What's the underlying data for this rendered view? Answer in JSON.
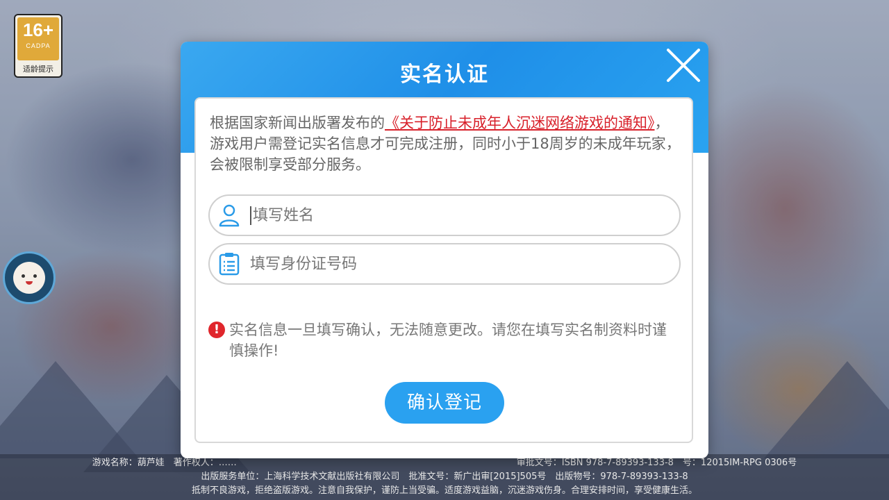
{
  "age_badge": {
    "rating": "16+",
    "org": "CADPA",
    "tip": "适龄提示"
  },
  "modal": {
    "title": "实名认证",
    "notice_prefix": "根据国家新闻出版署发布的",
    "notice_link": "《关于防止未成年人沉迷网络游戏的通知》",
    "notice_suffix": "，游戏用户需登记实名信息才可完成注册，同时小于18周岁的未成年玩家，会被限制享受部分服务。",
    "name_placeholder": "填写姓名",
    "id_placeholder": "填写身份证号码",
    "warning": "实名信息一旦填写确认，无法随意更改。请您在填写实名制资料时谨慎操作!",
    "confirm_label": "确认登记"
  },
  "footer": {
    "line1": "游戏名称：葫芦娃　著作权人：……　　　　　　　　　　　　　　　　　　　　　　　　　　　　　　　审批文号：ISBN 978-7-89393-133-8　号：12015IM-RPG 0306号",
    "line2": "出版服务单位：上海科学技术文献出版社有限公司　批准文号：新广出审[2015]505号　出版物号：978-7-89393-133-8",
    "line3": "抵制不良游戏，拒绝盗版游戏。注意自我保护，谨防上当受骗。适度游戏益脑，沉迷游戏伤身。合理安排时间，享受健康生活。"
  },
  "colors": {
    "accent": "#2aa1f0",
    "warning": "#e0262c",
    "link": "#d8202a"
  },
  "icons": {
    "close": "close-icon",
    "user": "user-icon",
    "id_card": "id-card-icon",
    "warn": "exclamation-icon"
  }
}
